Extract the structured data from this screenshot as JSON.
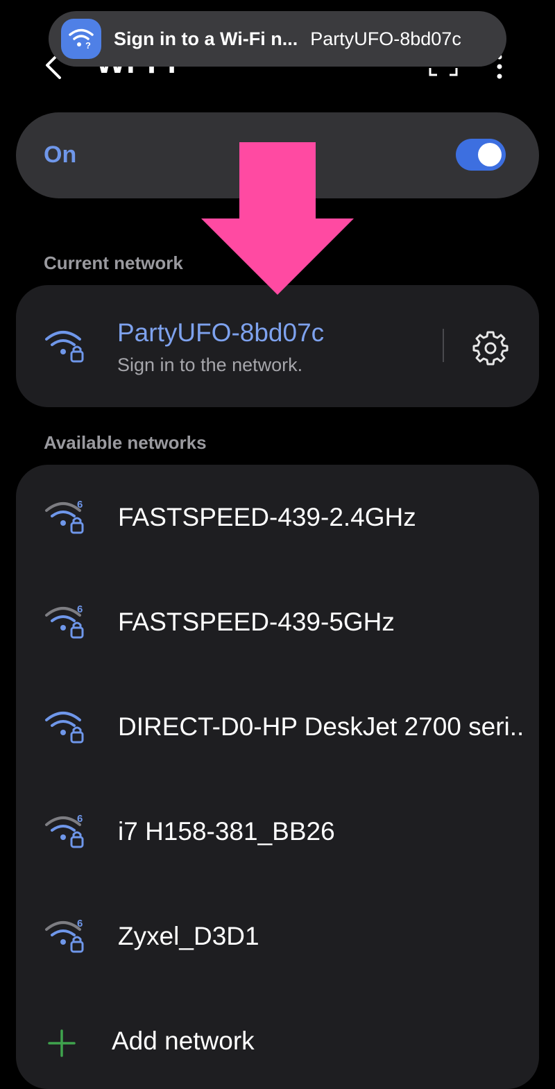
{
  "header": {
    "title": "Wi-Fi",
    "back_icon": "chevron-left-icon",
    "qr_icon": "qr-scan-icon",
    "more_icon": "more-vertical-icon"
  },
  "notification": {
    "icon": "wifi-question-icon",
    "title": "Sign in to a Wi-Fi n...",
    "text": "PartyUFO-8bd07c",
    "icon_bg_color": "#4f80e6"
  },
  "wifi_toggle": {
    "label": "On",
    "state": true,
    "accent_color": "#3d6fe0"
  },
  "current_network": {
    "section_label": "Current network",
    "name": "PartyUFO-8bd07c",
    "status": "Sign in to the network.",
    "icon": "wifi-lock-icon",
    "settings_icon": "gear-icon"
  },
  "available_networks": {
    "section_label": "Available networks",
    "items": [
      {
        "name": "FASTSPEED-439-2.4GHz",
        "icon": "wifi6-lock-icon"
      },
      {
        "name": "FASTSPEED-439-5GHz",
        "icon": "wifi6-lock-icon"
      },
      {
        "name": "DIRECT-D0-HP DeskJet 2700 seri..",
        "icon": "wifi-lock-icon"
      },
      {
        "name": "i7 H158-381_BB26",
        "icon": "wifi6-lock-icon"
      },
      {
        "name": "Zyxel_D3D1",
        "icon": "wifi6-lock-icon"
      }
    ],
    "add_label": "Add network",
    "add_icon": "plus-icon"
  },
  "overlay": {
    "arrow_icon": "down-arrow-icon",
    "arrow_color": "#ff4aa2"
  }
}
